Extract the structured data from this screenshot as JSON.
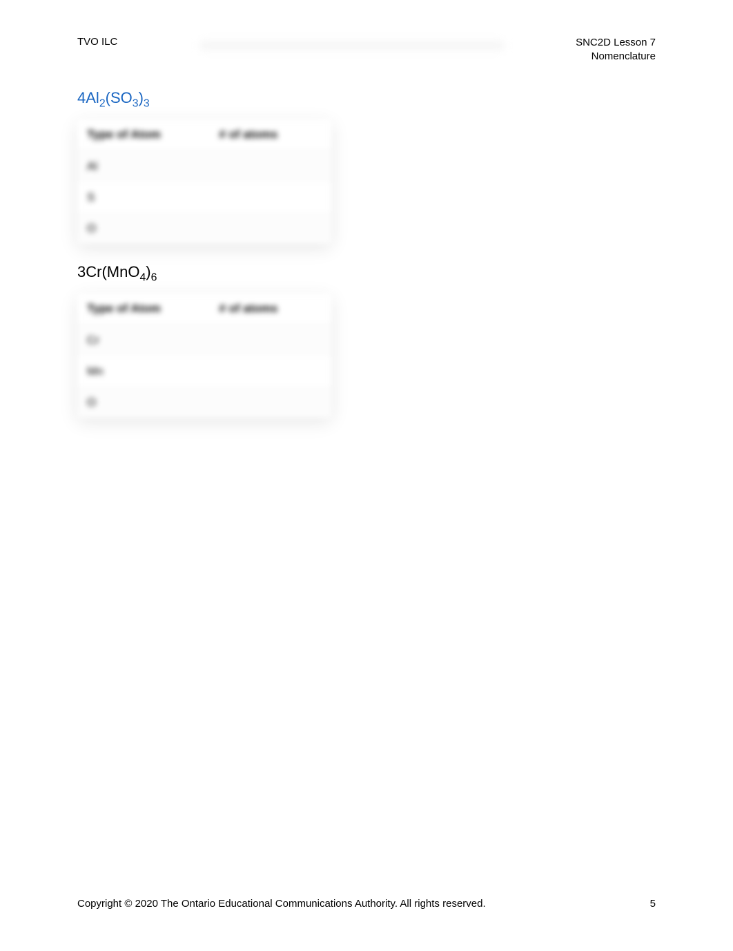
{
  "header": {
    "left": "TVO ILC",
    "right_line1": "SNC2D Lesson 7",
    "right_line2": "Nomenclature"
  },
  "formulas": {
    "f1": {
      "coef": "4",
      "el1": "Al",
      "sub1": "2",
      "openParen": "(",
      "el2": "SO",
      "sub2": "3",
      "closeParen": ")",
      "sub3": "3"
    },
    "f2": {
      "coef": "3",
      "el1": "Cr",
      "openParen": "(",
      "el2": "MnO",
      "sub2": "4",
      "closeParen": ")",
      "sub3": "6"
    }
  },
  "table": {
    "col1": "Type of Atom",
    "col2": "# of atoms"
  },
  "table1_rows": {
    "r1": "Al",
    "r2": "S",
    "r3": "O"
  },
  "table2_rows": {
    "r1": "Cr",
    "r2": "Mn",
    "r3": "O"
  },
  "footer": {
    "copyright": "Copyright © 2020 The Ontario Educational Communications Authority. All rights reserved.",
    "page": "5"
  }
}
